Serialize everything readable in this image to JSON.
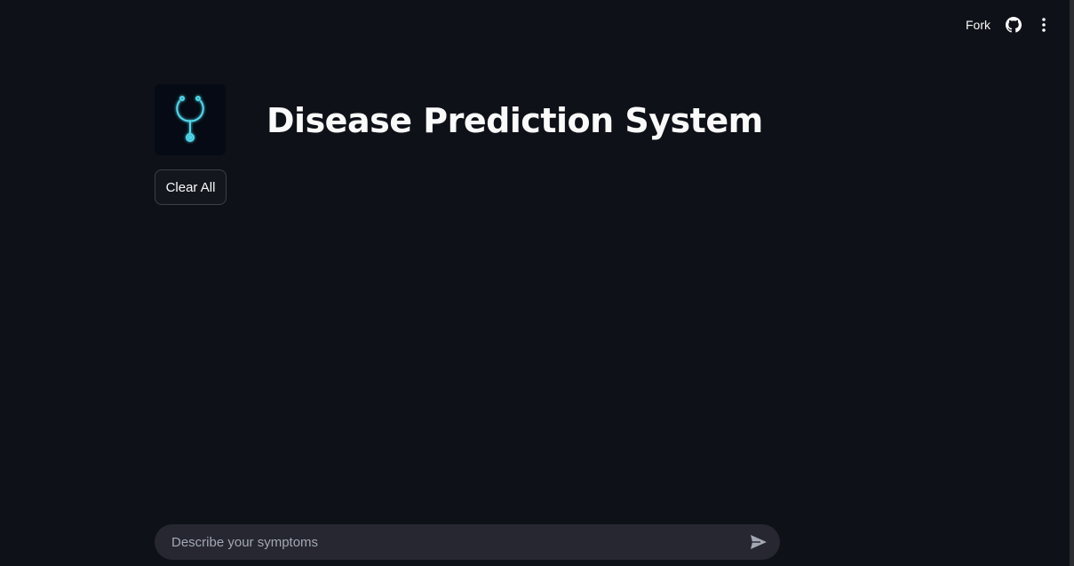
{
  "header": {
    "fork_label": "Fork",
    "icons": [
      "github-icon",
      "more-vertical-icon"
    ]
  },
  "main": {
    "logo_icon": "stethoscope-icon",
    "title": "Disease Prediction System",
    "clear_button_label": "Clear All"
  },
  "chat": {
    "placeholder": "Describe your symptoms",
    "value": "",
    "send_icon": "send-icon"
  },
  "colors": {
    "background": "#0e1117",
    "accent": "#4fd8eb",
    "input_background": "#262730"
  }
}
